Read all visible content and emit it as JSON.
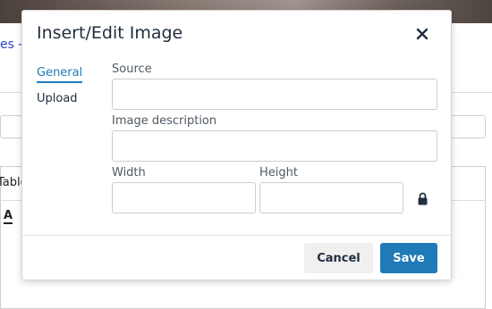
{
  "background": {
    "link_fragment": "es -",
    "menu_table": "Table",
    "menu_a": "A"
  },
  "dialog": {
    "title": "Insert/Edit Image",
    "close_icon": "close-icon",
    "tabs": [
      {
        "label": "General",
        "active": true
      },
      {
        "label": "Upload",
        "active": false
      }
    ],
    "fields": {
      "source_label": "Source",
      "source_value": "",
      "description_label": "Image description",
      "description_value": "",
      "width_label": "Width",
      "width_value": "",
      "height_label": "Height",
      "height_value": ""
    },
    "lock_icon": "lock-icon",
    "cancel_label": "Cancel",
    "save_label": "Save"
  },
  "colors": {
    "accent": "#207ab7",
    "cancel_bg": "#f0f0f0",
    "text": "#222f3e"
  }
}
